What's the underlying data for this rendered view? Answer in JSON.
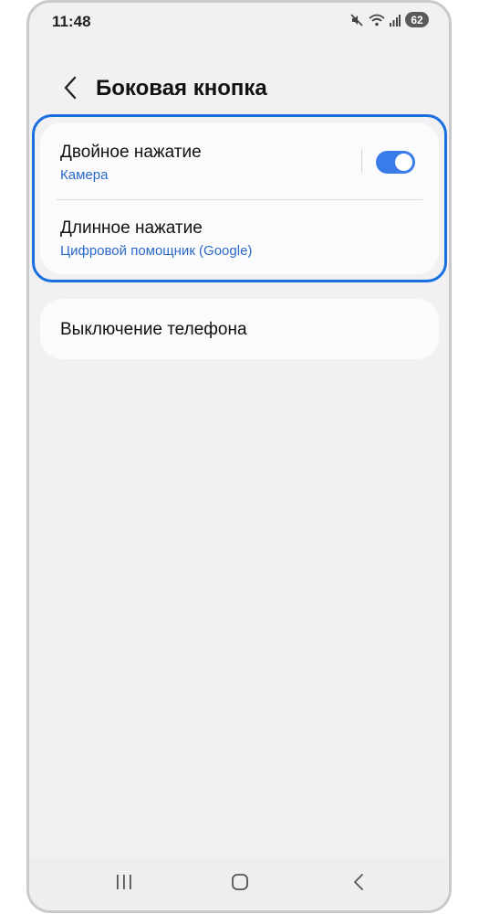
{
  "status_bar": {
    "time": "11:48",
    "battery": "62",
    "icons": [
      "mute-icon",
      "wifi-icon",
      "signal-icon",
      "battery-icon"
    ]
  },
  "header": {
    "back_icon": "chevron-left-icon",
    "title": "Боковая кнопка"
  },
  "settings": {
    "double_press": {
      "title": "Двойное нажатие",
      "value": "Камера",
      "enabled": true
    },
    "long_press": {
      "title": "Длинное нажатие",
      "value": "Цифровой помощник (Google)"
    },
    "power_off": {
      "title": "Выключение телефона"
    }
  },
  "navigation": {
    "buttons": [
      "recents-icon",
      "home-icon",
      "back-icon"
    ]
  },
  "colors": {
    "accent": "#3a7bea",
    "subtitle": "#2a69c9",
    "highlight_frame": "#1a6fe0",
    "background": "#f1f1f3",
    "card": "#fbfbfd"
  }
}
